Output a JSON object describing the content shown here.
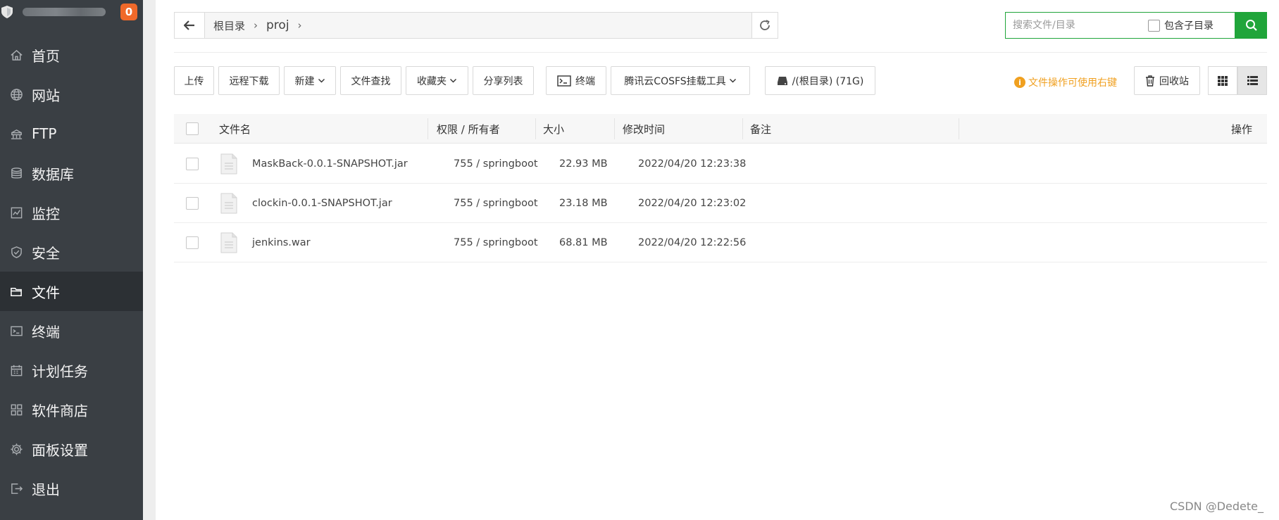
{
  "sidebar": {
    "badge": "0",
    "items": [
      {
        "label": "首页",
        "icon": "home-icon"
      },
      {
        "label": "网站",
        "icon": "globe-icon"
      },
      {
        "label": "FTP",
        "icon": "ftp-icon"
      },
      {
        "label": "数据库",
        "icon": "database-icon"
      },
      {
        "label": "监控",
        "icon": "monitor-icon"
      },
      {
        "label": "安全",
        "icon": "shield-icon"
      },
      {
        "label": "文件",
        "icon": "folder-icon"
      },
      {
        "label": "终端",
        "icon": "terminal-icon"
      },
      {
        "label": "计划任务",
        "icon": "calendar-icon"
      },
      {
        "label": "软件商店",
        "icon": "grid-icon"
      },
      {
        "label": "面板设置",
        "icon": "gear-icon"
      },
      {
        "label": "退出",
        "icon": "logout-icon"
      }
    ],
    "active": "文件"
  },
  "pathbar": {
    "root": "根目录",
    "current": "proj"
  },
  "search": {
    "placeholder": "搜索文件/目录",
    "include_sub": "包含子目录"
  },
  "toolbar": {
    "upload": "上传",
    "remote_download": "远程下载",
    "new": "新建",
    "file_search": "文件查找",
    "favorites": "收藏夹",
    "share_list": "分享列表",
    "terminal": "终端",
    "cosfs": "腾讯云COSFS挂载工具",
    "disk": "/(根目录) (71G)",
    "hint": "文件操作可使用右键",
    "recycle": "回收站"
  },
  "table": {
    "headers": {
      "name": "文件名",
      "perm": "权限 / 所有者",
      "size": "大小",
      "mtime": "修改时间",
      "remark": "备注",
      "action": "操作"
    },
    "rows": [
      {
        "name": "MaskBack-0.0.1-SNAPSHOT.jar",
        "perm": "755 / springboot",
        "size": "22.93 MB",
        "mtime": "2022/04/20 12:23:38"
      },
      {
        "name": "clockin-0.0.1-SNAPSHOT.jar",
        "perm": "755 / springboot",
        "size": "23.18 MB",
        "mtime": "2022/04/20 12:23:02"
      },
      {
        "name": "jenkins.war",
        "perm": "755 / springboot",
        "size": "68.81 MB",
        "mtime": "2022/04/20 12:22:56"
      }
    ]
  },
  "watermark": "CSDN @Dedete_",
  "colors": {
    "sidebar_bg": "#3a3f44",
    "sidebar_active": "#2c3034",
    "accent_green": "#20a53a",
    "badge_orange": "#f0692a",
    "hint_orange": "#f0a020"
  }
}
